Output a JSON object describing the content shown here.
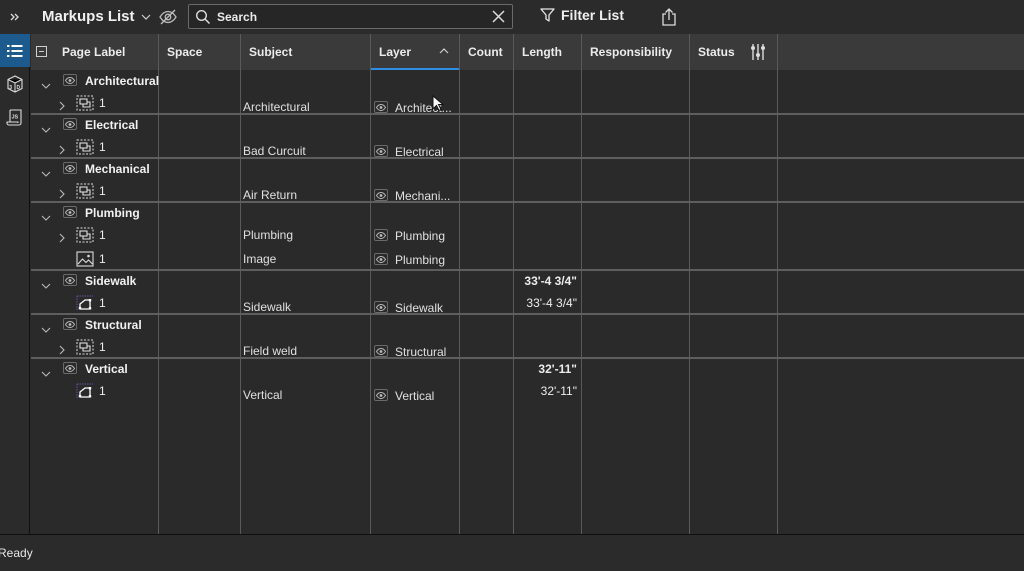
{
  "toolbar": {
    "expand_icon": "double-chevron-right-icon",
    "title": "Markups List",
    "search": {
      "placeholder": "Search",
      "value": ""
    },
    "filter_label": "Filter List"
  },
  "sidebar": {
    "items": [
      {
        "name": "markups-list",
        "icon": "list-icon",
        "active": true
      },
      {
        "name": "3d",
        "icon": "3d-cube-icon",
        "active": false
      },
      {
        "name": "scripts",
        "icon": "js-script-icon",
        "active": false
      }
    ]
  },
  "columns": [
    {
      "key": "page_label",
      "label": "Page Label"
    },
    {
      "key": "space",
      "label": "Space"
    },
    {
      "key": "subject",
      "label": "Subject"
    },
    {
      "key": "layer",
      "label": "Layer",
      "sorted": "ascending"
    },
    {
      "key": "count",
      "label": "Count"
    },
    {
      "key": "length",
      "label": "Length"
    },
    {
      "key": "responsibility",
      "label": "Responsibility"
    },
    {
      "key": "status",
      "label": "Status"
    }
  ],
  "groups": [
    {
      "name": "Architectural",
      "expanded": true,
      "total_length": "",
      "rows": [
        {
          "icon": "markup-group-icon",
          "expandable": true,
          "page": "1",
          "subject": "Architectural",
          "layer": "Architect...",
          "length": ""
        }
      ]
    },
    {
      "name": "Electrical",
      "expanded": true,
      "total_length": "",
      "rows": [
        {
          "icon": "markup-group-icon",
          "expandable": true,
          "page": "1",
          "subject": "Bad Curcuit",
          "layer": "Electrical",
          "length": ""
        }
      ]
    },
    {
      "name": "Mechanical",
      "expanded": true,
      "total_length": "",
      "rows": [
        {
          "icon": "markup-group-icon",
          "expandable": true,
          "page": "1",
          "subject": "Air Return",
          "layer": "Mechani...",
          "length": ""
        }
      ]
    },
    {
      "name": "Plumbing",
      "expanded": true,
      "total_length": "",
      "rows": [
        {
          "icon": "markup-group-icon",
          "expandable": true,
          "page": "1",
          "subject": "Plumbing",
          "layer": "Plumbing",
          "length": ""
        },
        {
          "icon": "image-icon",
          "expandable": false,
          "page": "1",
          "subject": "Image",
          "layer": "Plumbing",
          "length": ""
        }
      ]
    },
    {
      "name": "Sidewalk",
      "expanded": true,
      "total_length": "33'-4 3/4\"",
      "rows": [
        {
          "icon": "polyline-icon",
          "expandable": false,
          "page": "1",
          "subject": "Sidewalk",
          "layer": "Sidewalk",
          "length": "33'-4 3/4\""
        }
      ]
    },
    {
      "name": "Structural",
      "expanded": true,
      "total_length": "",
      "rows": [
        {
          "icon": "markup-group-icon",
          "expandable": true,
          "page": "1",
          "subject": "Field weld",
          "layer": "Structural",
          "length": ""
        }
      ]
    },
    {
      "name": "Vertical",
      "expanded": true,
      "total_length": "32'-11\"",
      "rows": [
        {
          "icon": "polyline-icon",
          "expandable": false,
          "page": "1",
          "subject": "Vertical",
          "layer": "Vertical",
          "length": "32'-11\""
        }
      ]
    }
  ],
  "status_bar": {
    "text": "Ready"
  }
}
